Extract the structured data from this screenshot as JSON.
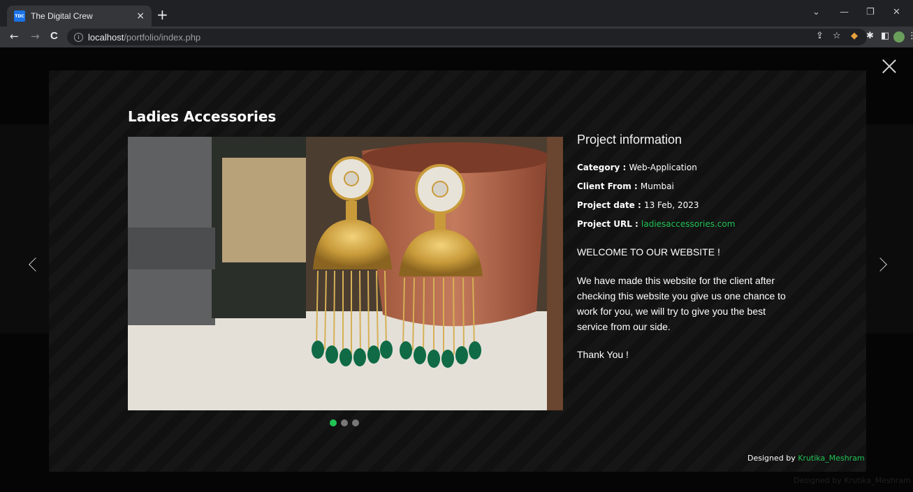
{
  "browser": {
    "tab": {
      "title": "The Digital Crew",
      "favicon_text": "TDC",
      "close": "×"
    },
    "new_tab": "+",
    "window_controls": {
      "minimize": "—",
      "restore": "❐",
      "close": "✕",
      "dropdown": "⌄"
    },
    "nav": {
      "back": "←",
      "forward": "→",
      "reload": "C"
    },
    "address": {
      "host": "localhost",
      "path": "/portfolio/index.php"
    }
  },
  "modal": {
    "title": "Ladies Accessories",
    "image_alt": "jhumka earrings with green beads",
    "info": {
      "heading": "Project information",
      "fields": [
        {
          "label": "Category",
          "value": "Web-Application"
        },
        {
          "label": "Client From",
          "value": "Mumbai"
        },
        {
          "label": "Project date",
          "value": "13 Feb, 2023"
        },
        {
          "label": "Project URL",
          "value": "ladiesaccessories.com"
        }
      ],
      "welcome": "WELCOME TO OUR WEBSITE !",
      "body": "We have made this website for the client after checking this website you give us one chance to work for you, we will try to give you the best service from our side.",
      "thanks": "Thank You !"
    },
    "carousel": {
      "slides": 3,
      "active": 0
    }
  },
  "footer": {
    "designed_by": "Designed by",
    "author": "Krutika_Meshram"
  },
  "colors": {
    "accent": "#21c354",
    "chrome_bg": "#202124",
    "toolbar_bg": "#35363a"
  }
}
